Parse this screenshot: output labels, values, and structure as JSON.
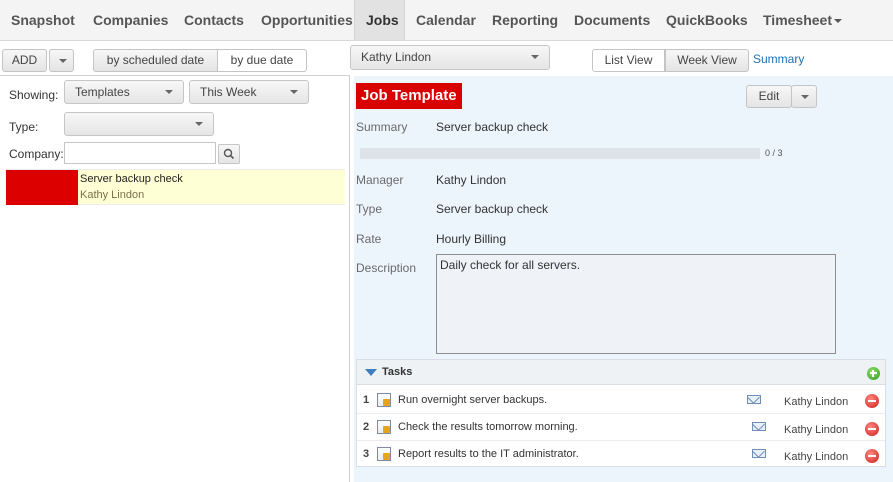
{
  "nav": {
    "items": [
      {
        "label": "Snapshot"
      },
      {
        "label": "Companies"
      },
      {
        "label": "Contacts"
      },
      {
        "label": "Opportunities"
      },
      {
        "label": "Jobs"
      },
      {
        "label": "Calendar"
      },
      {
        "label": "Reporting"
      },
      {
        "label": "Documents"
      },
      {
        "label": "QuickBooks"
      },
      {
        "label": "Timesheet"
      }
    ],
    "active": "Jobs"
  },
  "toolbar": {
    "add_label": "ADD",
    "by_scheduled_label": "by scheduled date",
    "by_due_label": "by due date",
    "user_select": "Kathy Lindon",
    "list_view_label": "List View",
    "week_view_label": "Week View",
    "summary_label": "Summary"
  },
  "filters": {
    "showing_label": "Showing:",
    "showing_value": "Templates",
    "period_value": "This Week",
    "type_label": "Type:",
    "type_value": "",
    "company_label": "Company:",
    "company_value": ""
  },
  "results": [
    {
      "title": "Server backup check",
      "person": "Kathy Lindon",
      "color": "#dd0000"
    }
  ],
  "job": {
    "header": "Job Template",
    "edit_label": "Edit",
    "summary_label": "Summary",
    "summary_value": "Server backup check",
    "progress": {
      "done": 0,
      "total": 3,
      "text": "0 / 3"
    },
    "manager_label": "Manager",
    "manager_value": "Kathy Lindon",
    "type_label": "Type",
    "type_value": "Server backup check",
    "rate_label": "Rate",
    "rate_value": "Hourly Billing",
    "description_label": "Description",
    "description_value": "Daily check for all servers."
  },
  "tasks": {
    "title": "Tasks",
    "items": [
      {
        "num": "1",
        "name": "Run overnight server backups.",
        "assignee": "Kathy Lindon"
      },
      {
        "num": "2",
        "name": "Check the results tomorrow morning.",
        "assignee": "Kathy Lindon"
      },
      {
        "num": "3",
        "name": "Report results to the IT administrator.",
        "assignee": "Kathy Lindon"
      }
    ]
  },
  "colors": {
    "accent": "#d80000",
    "link": "#1f6fb2",
    "panel_bg": "#ecf4fc",
    "selected_row": "#ffffd6"
  }
}
